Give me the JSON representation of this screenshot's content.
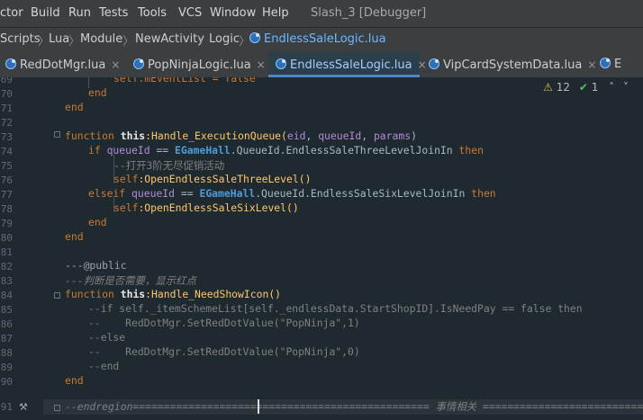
{
  "menu": {
    "items": [
      {
        "label": "ctor",
        "ul": ""
      },
      {
        "label": "Build",
        "ul": "B"
      },
      {
        "label": "Run",
        "ul": "R"
      },
      {
        "label": "Tests",
        "ul": "T"
      },
      {
        "label": "Tools",
        "ul": "o"
      },
      {
        "label": "VCS",
        "ul": "S"
      },
      {
        "label": "Window",
        "ul": "W"
      },
      {
        "label": "Help",
        "ul": "H"
      }
    ],
    "window_title": "Slash_3 [Debugger]"
  },
  "breadcrumbs": [
    "Scripts",
    "Lua",
    "Module",
    "NewActivity",
    "Logic",
    "EndlessSaleLogic.lua"
  ],
  "tabs": [
    {
      "label": "RedDotMgr.lua",
      "active": false
    },
    {
      "label": "PopNinjaLogic.lua",
      "active": false
    },
    {
      "label": "EndlessSaleLogic.lua",
      "active": true
    },
    {
      "label": "VipCardSystemData.lua",
      "active": false
    },
    {
      "label": "E",
      "active": false
    }
  ],
  "inspections": {
    "warnings": "12",
    "ok": "1"
  },
  "line_numbers": [
    "69",
    "70",
    "71",
    "72",
    "73",
    "74",
    "75",
    "76",
    "77",
    "78",
    "79",
    "80",
    "81",
    "82",
    "83",
    "84",
    "85",
    "86",
    "87",
    "88",
    "89",
    "90",
    "91"
  ],
  "code": {
    "l69": "self.mEventList = false",
    "l70_end": "end",
    "l71_end": "end",
    "fn1_kw": "function",
    "fn1_this": "this",
    "fn1_name": ":Handle_ExecutionQueue(",
    "fn1_p1": "eid",
    "fn1_p2": "queueId",
    "fn1_p3": "params",
    "fn1_close": ")",
    "if_kw": "if",
    "q": "queueId",
    "eq": "==",
    "egame": "EGameHall",
    "three": ".QueueId.EndlessSaleThreeLevelJoinIn",
    "then": "then",
    "comment74": "--打开3阶无尽促销活动",
    "self": "self",
    "call75": ":OpenEndlessSaleThreeLevel()",
    "elseif": "elseif",
    "six": ".QueueId.EndlessSaleSixLevelJoinIn",
    "call77": ":OpenEndlessSaleSixLevel()",
    "end": "end",
    "l81": "---@public",
    "l82": "---判断是否需要，显示红点",
    "fn2_name": ":Handle_NeedShowIcon()",
    "l84": "--if self._itemSchemeList[self._endlessData.StartShopID].IsNeedPay == false then",
    "l85": "--    RedDotMgr.SetRedDotValue(\"PopNinja\",1)",
    "l86": "--else",
    "l87": "--    RedDotMgr.SetRedDotValue(\"PopNinja\",0)",
    "l88": "--end",
    "l91": "--endregion================================================ 事情相关 ================================="
  }
}
